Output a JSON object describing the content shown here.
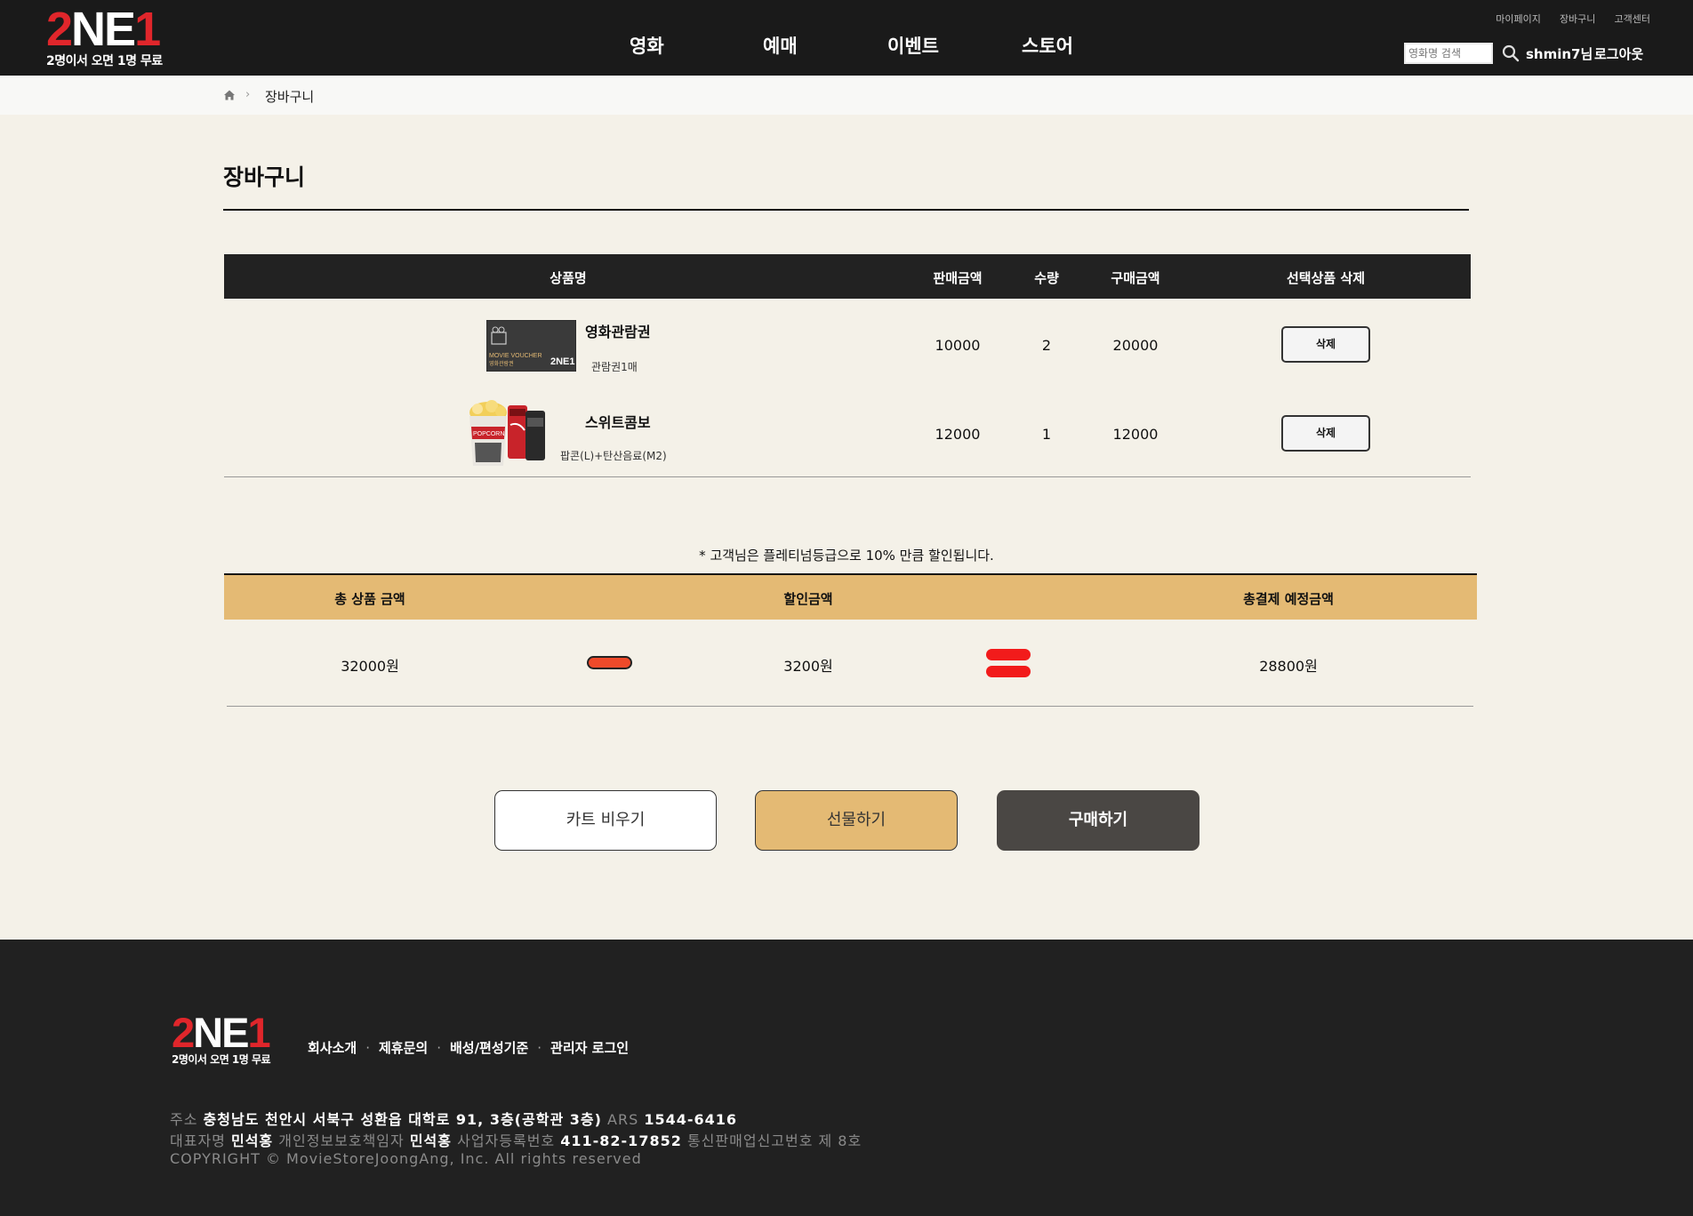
{
  "header": {
    "logo_main_red": "2",
    "logo_main_white": "NE",
    "logo_main_red2": "1",
    "logo_sub": "2명이서 오면 1명 무료",
    "nav": [
      "영화",
      "예매",
      "이벤트",
      "스토어"
    ],
    "util": [
      "마이페이지",
      "장바구니",
      "고객센터"
    ],
    "search_placeholder": "영화명 검색",
    "user_name": "shmin7님",
    "logout": "로그아웃"
  },
  "breadcrumb": {
    "current": "장바구니"
  },
  "page_title": "장바구니",
  "cart": {
    "columns": [
      "상품명",
      "판매금액",
      "수량",
      "구매금액",
      "선택상품 삭제"
    ],
    "items": [
      {
        "name": "영화관람권",
        "desc": "관람권1매",
        "image_icon": "movie-voucher-icon",
        "image_caption": "MOVIE VOUCHER",
        "image_caption2": "영화관람권",
        "price": "10000",
        "qty": "2",
        "total": "20000",
        "delete": "삭제"
      },
      {
        "name": "스위트콤보",
        "desc": "팝콘(L)+탄산음료(M2)",
        "image_icon": "popcorn-combo-icon",
        "image_caption": "POPCORN",
        "price": "12000",
        "qty": "1",
        "total": "12000",
        "delete": "삭제"
      }
    ]
  },
  "summary": {
    "note": "* 고객님은 플레티넘등급으로 10% 만큼 할인됩니다.",
    "headers": [
      "총 상품 금액",
      "할인금액",
      "총결제 예정금액"
    ],
    "total_product": "32000원",
    "discount": "3200원",
    "final": "28800원",
    "colors": {
      "header_bg": "#e4ba74",
      "minus": "#ef4a2a",
      "equals": "#f21b1b"
    }
  },
  "actions": {
    "clear": "카트 비우기",
    "gift": "선물하기",
    "buy": "구매하기"
  },
  "footer": {
    "links": [
      "회사소개",
      "제휴문의",
      "배성/편성기준",
      "관리자 로그인"
    ],
    "line1": {
      "addr_label": "주소",
      "addr": "충청남도 천안시 서북구 성환읍 대학로 91, 3층(공학관 3층)",
      "ars_label": "ARS",
      "ars": "1544-6416"
    },
    "line2": {
      "ceo_label": "대표자명",
      "ceo": "민석홍",
      "privacy_label": "개인정보보호책임자",
      "privacy": "민석홍",
      "biz_label": "사업자등록번호",
      "biz": "411-82-17852",
      "mail_order_label": "통신판매업신고번호 제 8호"
    },
    "copyright": "COPYRIGHT © MovieStoreJoongAng, Inc. All rights reserved"
  }
}
